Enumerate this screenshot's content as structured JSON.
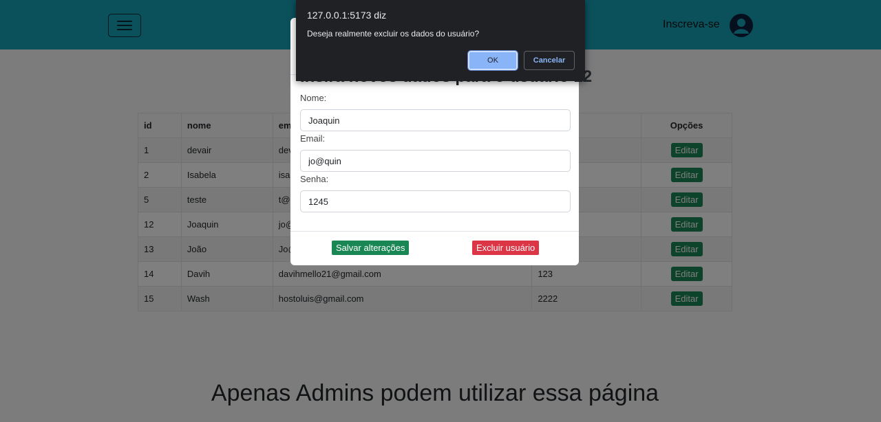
{
  "navbar": {
    "menu_icon": "hamburger-menu-icon",
    "signup_label": "Inscreva-se",
    "avatar_icon": "user-avatar-icon",
    "bg_color": "#17a2b8"
  },
  "table": {
    "headers": {
      "id": "id",
      "nome": "nome",
      "email": "em",
      "options": "Opções"
    },
    "rows": [
      {
        "id": "1",
        "nome": "devair",
        "email": "dev",
        "senha": "",
        "action": "Editar"
      },
      {
        "id": "2",
        "nome": "Isabela",
        "email": "isal",
        "senha": "",
        "action": "Editar"
      },
      {
        "id": "5",
        "nome": "teste",
        "email": "t@",
        "senha": "",
        "action": "Editar"
      },
      {
        "id": "12",
        "nome": "Joaquin",
        "email": "jo@",
        "senha": "",
        "action": "Editar"
      },
      {
        "id": "13",
        "nome": "João",
        "email": "Jo@",
        "senha": "",
        "action": "Editar"
      },
      {
        "id": "14",
        "nome": "Davih",
        "email": "davihmello21@gmail.com",
        "senha": "123",
        "action": "Editar"
      },
      {
        "id": "15",
        "nome": "Wash",
        "email": "hostoluis@gmail.com",
        "senha": "2222",
        "action": "Editar"
      }
    ]
  },
  "admin_notice": "Apenas Admins podem utilizar essa página",
  "modal": {
    "title": "Insira novos dados para o usuário 12",
    "fields": {
      "nome": {
        "label": "Nome:",
        "value": "Joaquin"
      },
      "email": {
        "label": "Email:",
        "value": "jo@quin"
      },
      "senha": {
        "label": "Senha:",
        "value": "1245"
      }
    },
    "save_label": "Salvar alterações",
    "delete_label": "Excluir usuário"
  },
  "alert": {
    "origin": "127.0.0.1:5173 diz",
    "message": "Deseja realmente excluir os dados do usuário?",
    "ok_label": "OK",
    "cancel_label": "Cancelar"
  },
  "colors": {
    "edit": "#198754",
    "delete": "#dc3545",
    "alert_bg": "#202124",
    "alert_accent": "#8ab4f8"
  }
}
